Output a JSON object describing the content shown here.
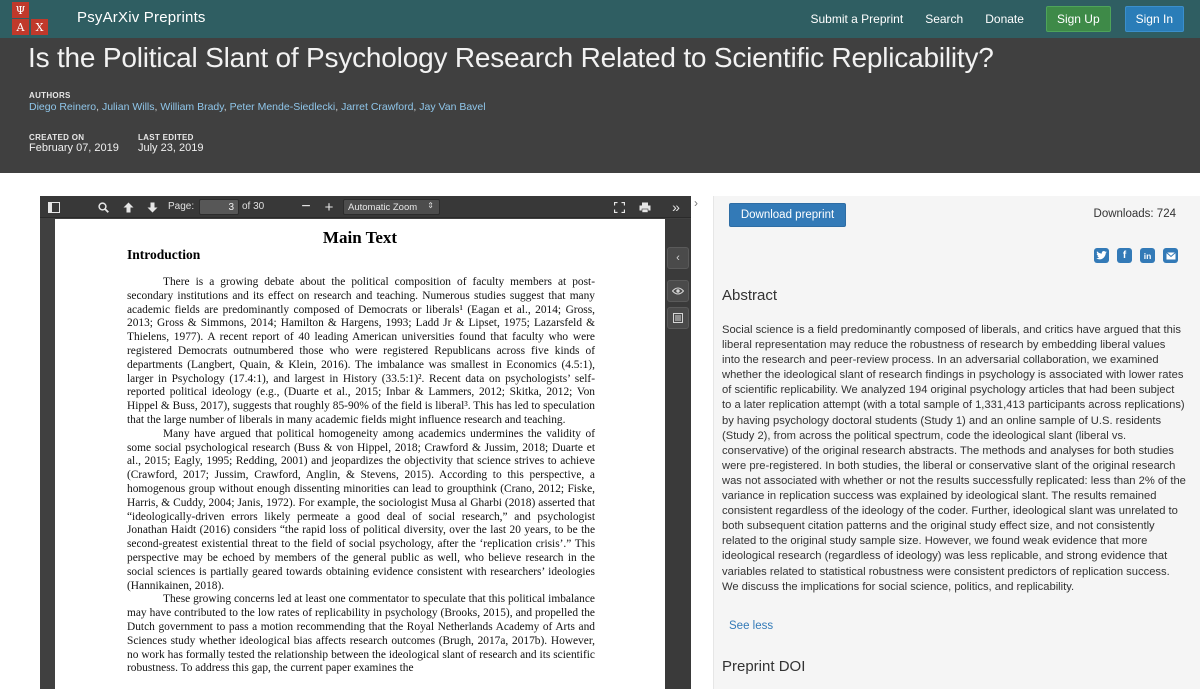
{
  "navbar": {
    "logo_letters": [
      "Ψ",
      "A",
      "X"
    ],
    "brand": "PsyArXiv Preprints",
    "links": [
      "Submit a Preprint",
      "Search",
      "Donate"
    ],
    "signup": "Sign Up",
    "signin": "Sign In",
    "color": "#2f5e62"
  },
  "header": {
    "title": "Is the Political Slant of Psychology Research Related to Scientific Replicability?",
    "authors_label": "AUTHORS",
    "authors": [
      "Diego Reinero",
      "Julian Wills",
      "William Brady",
      "Peter Mende-Siedlecki",
      "Jarret Crawford",
      "Jay Van Bavel"
    ],
    "created_label": "CREATED ON",
    "created": "February 07, 2019",
    "edited_label": "LAST EDITED",
    "edited": "July 23, 2019"
  },
  "viewer": {
    "page_label": "Page:",
    "page_current": "3",
    "page_total": "of 30",
    "zoom": "Automatic Zoom",
    "icons": [
      "sidebar-toggle-icon",
      "search-icon",
      "previous-page-icon",
      "next-page-icon",
      "zoom-out-icon",
      "zoom-in-icon",
      "fullscreen-icon",
      "print-icon",
      "more-tools-icon"
    ],
    "pdf": {
      "heading": "Main Text",
      "section": "Introduction",
      "paragraphs": [
        "There is a growing debate about the political composition of faculty members at post-secondary institutions and its effect on research and teaching. Numerous studies suggest that many academic fields are predominantly composed of Democrats or liberals¹ (Eagan et al., 2014; Gross, 2013; Gross & Simmons, 2014; Hamilton & Hargens, 1993; Ladd Jr & Lipset, 1975; Lazarsfeld & Thielens, 1977). A recent report of 40 leading American universities found that faculty who were registered Democrats outnumbered those who were registered Republicans across five kinds of departments (Langbert, Quain, & Klein, 2016). The imbalance was smallest in Economics (4.5:1), larger in Psychology (17.4:1), and largest in History (33.5:1)². Recent data on psychologists’ self-reported political ideology (e.g., (Duarte et al., 2015; Inbar & Lammers, 2012; Skitka, 2012; Von Hippel & Buss, 2017), suggests that roughly 85-90% of the field is liberal³. This has led to speculation that the large number of liberals in many academic fields might influence research and teaching.",
        "Many have argued that political homogeneity among academics undermines the validity of some social psychological research (Buss & von Hippel, 2018; Crawford & Jussim, 2018; Duarte et al., 2015; Eagly, 1995; Redding, 2001) and jeopardizes the objectivity that science strives to achieve (Crawford, 2017; Jussim, Crawford, Anglin, & Stevens, 2015). According to this perspective, a homogenous group without enough dissenting minorities can lead to groupthink (Crano, 2012; Fiske, Harris, & Cuddy, 2004; Janis, 1972). For example, the sociologist Musa al Gharbi (2018) asserted that “ideologically-driven errors likely permeate a good deal of social research,” and psychologist Jonathan Haidt (2016) considers “the rapid loss of political diversity, over the last 20 years, to be the second-greatest existential threat to the field of social psychology, after the ‘replication crisis’.” This perspective may be echoed by members of the general public as well, who believe research in the social sciences is partially geared towards obtaining evidence consistent with researchers’ ideologies (Hannikainen, 2018).",
        "These growing concerns led at least one commentator to speculate that this political imbalance may have contributed to the low rates of replicability in psychology (Brooks, 2015), and propelled the Dutch government to pass a motion recommending that the Royal Netherlands Academy of Arts and Sciences study whether ideological bias affects research outcomes (Brugh, 2017a, 2017b). However, no work has formally tested the relationship between the ideological slant of research and its scientific robustness. To address this gap, the current paper examines the"
      ]
    }
  },
  "panel": {
    "download": "Download preprint",
    "downloads": "Downloads: 724",
    "share_icons": [
      "twitter-icon",
      "facebook-icon",
      "linkedin-icon",
      "email-icon"
    ],
    "abstract_title": "Abstract",
    "abstract": "Social science is a field predominantly composed of liberals, and critics have argued that this liberal representation may reduce the robustness of research by embedding liberal values into the research and peer-review process. In an adversarial collaboration, we examined whether the ideological slant of research findings in psychology is associated with lower rates of scientific replicability. We analyzed 194 original psychology articles that had been subject to a later replication attempt (with a total sample of 1,331,413 participants across replications) by having psychology doctoral students (Study 1) and an online sample of U.S. residents (Study 2), from across the political spectrum, code the ideological slant (liberal vs. conservative) of the original research abstracts. The methods and analyses for both studies were pre-registered. In both studies, the liberal or conservative slant of the original research was not associated with whether or not the results successfully replicated: less than 2% of the variance in replication success was explained by ideological slant. The results remained consistent regardless of the ideology of the coder. Further, ideological slant was unrelated to both subsequent citation patterns and the original study effect size, and not consistently related to the original study sample size. However, we found weak evidence that more ideological research (regardless of ideology) was less replicable, and strong evidence that variables related to statistical robustness were consistent predictors of replication success. We discuss the implications for social science, politics, and replicability.",
    "see_less": "See less",
    "doi_title": "Preprint DOI"
  }
}
